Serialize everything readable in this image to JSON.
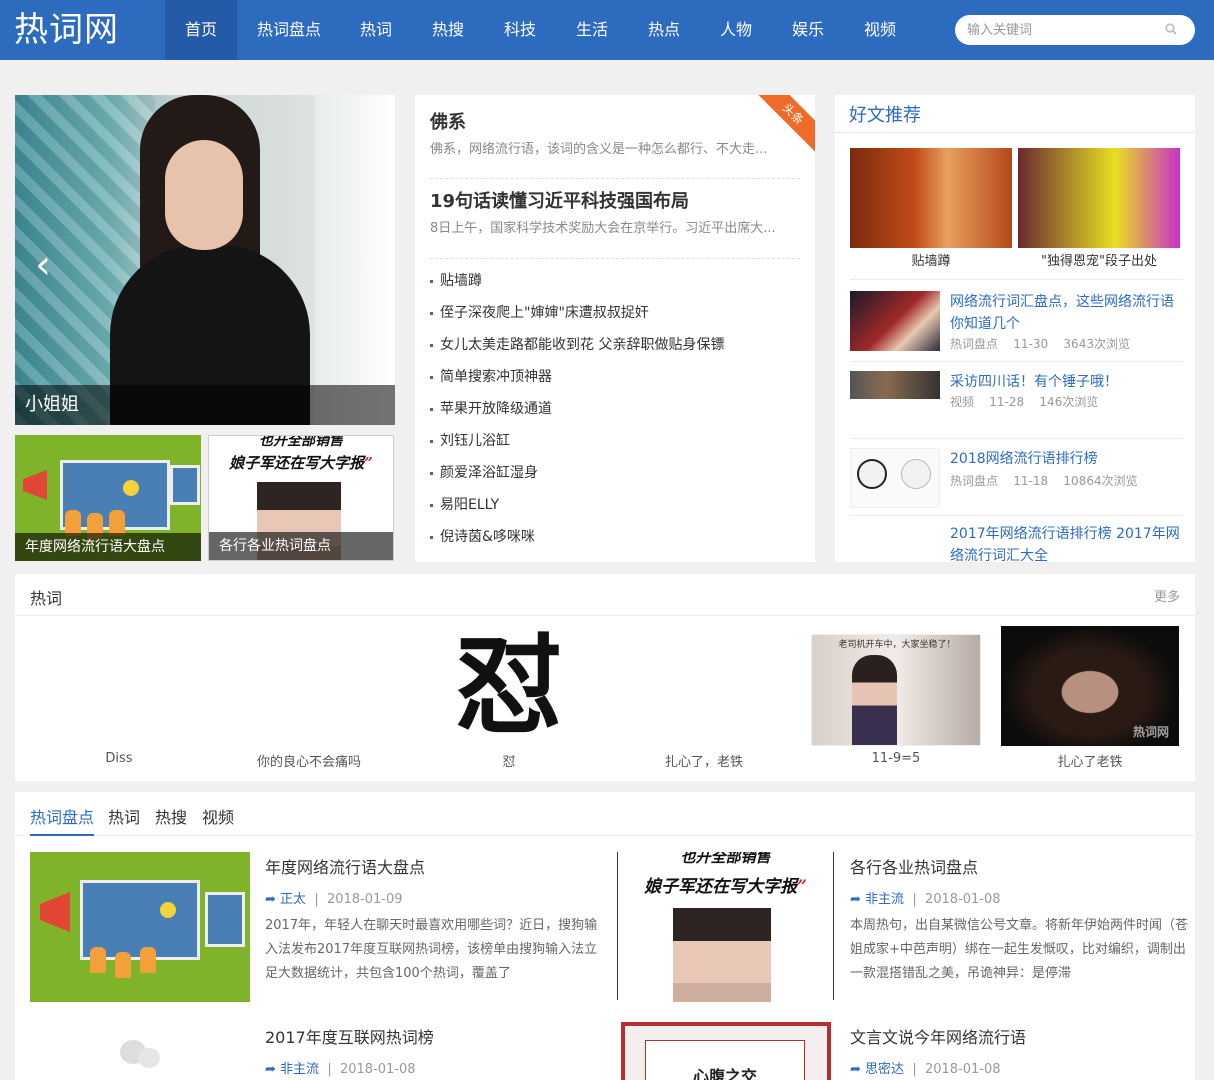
{
  "site": {
    "logo": "热词网"
  },
  "nav": [
    {
      "label": "首页",
      "active": true
    },
    {
      "label": "热词盘点"
    },
    {
      "label": "热词"
    },
    {
      "label": "热搜"
    },
    {
      "label": "科技"
    },
    {
      "label": "生活"
    },
    {
      "label": "热点"
    },
    {
      "label": "人物"
    },
    {
      "label": "娱乐"
    },
    {
      "label": "视频"
    }
  ],
  "search": {
    "placeholder": "输入关键词"
  },
  "banner": {
    "caption": "小姐姐"
  },
  "thumbs": [
    {
      "caption": "年度网络流行语大盘点"
    },
    {
      "caption": "各行各业热词盘点"
    }
  ],
  "poster": {
    "line1": "也开全部销售",
    "line2a": "娘子军还在写大字报",
    "line2b": "”"
  },
  "news": {
    "badge": "头条",
    "headlines": [
      {
        "title": "佛系",
        "summary": "佛系，网络流行语，该词的含义是一种怎么都行、不大走..."
      },
      {
        "title": "19句话读懂习近平科技强国布局",
        "summary": "8日上午，国家科学技术奖励大会在京举行。习近平出席大..."
      }
    ],
    "list": [
      "贴墙蹲",
      "侄子深夜爬上\"婶婶\"床遭叔叔捉奸",
      "女儿太美走路都能收到花 父亲辞职做贴身保镖",
      "简单搜索冲顶神器",
      "苹果开放降级通道",
      "刘钰儿浴缸",
      "颜爱泽浴缸湿身",
      "易阳ELLY",
      "倪诗茵&哆咪咪"
    ]
  },
  "recommend": {
    "title": "好文推荐",
    "images": [
      {
        "caption": "贴墙蹲"
      },
      {
        "caption": "\"独得恩宠\"段子出处"
      }
    ],
    "items": [
      {
        "title": "网络流行词汇盘点，这些网络流行语你知道几个",
        "category": "热词盘点",
        "date": "11-30",
        "views": "3643次浏览"
      },
      {
        "title": "采访四川话！有个锤子哦！",
        "category": "视频",
        "date": "11-28",
        "views": "146次浏览"
      },
      {
        "title": "2018网络流行语排行榜",
        "category": "热词盘点",
        "date": "11-18",
        "views": "10864次浏览"
      },
      {
        "title": "2017年网络流行语排行榜 2017年网络流行词汇大全",
        "category": "",
        "date": "",
        "views": ""
      }
    ]
  },
  "hot": {
    "title": "热词",
    "more": "更多",
    "calligraphy": "怼",
    "overlay_text": "老司机开车中，大家坐稳了！",
    "watermark": "热词网",
    "items": [
      {
        "caption": "Diss"
      },
      {
        "caption": "你的良心不会痛吗"
      },
      {
        "caption": "怼"
      },
      {
        "caption": "扎心了，老铁"
      },
      {
        "caption": "11-9=5"
      },
      {
        "caption": "扎心了老铁"
      }
    ]
  },
  "bottom": {
    "tabs": [
      {
        "label": "热词盘点",
        "active": true
      },
      {
        "label": "热词"
      },
      {
        "label": "热搜"
      },
      {
        "label": "视频"
      }
    ],
    "articles": [
      {
        "title": "年度网络流行语大盘点",
        "source": "正太",
        "date": "2018-01-09",
        "desc": "2017年，年轻人在聊天时最喜欢用哪些词？近日，搜狗输入法发布2017年度互联网热词榜，该榜单由搜狗输入法立足大数据统计，共包含100个热词，覆盖了"
      },
      {
        "title": "各行各业热词盘点",
        "source": "非主流",
        "date": "2018-01-08",
        "desc": "本周热句，出自某微信公号文章。将新年伊始两件时闻（苍姐成家+中芭声明）绑在一起生发慨叹，比对编织，调制出一款混搭错乱之美，吊诡神异：是停滞"
      },
      {
        "title": "2017年度互联网热词榜",
        "source": "非主流",
        "date": "2018-01-08",
        "desc": ""
      },
      {
        "title": "文言文说今年网络流行语",
        "source": "思密达",
        "date": "2018-01-08",
        "desc": ""
      }
    ],
    "poster2_text": "心腹之交"
  }
}
